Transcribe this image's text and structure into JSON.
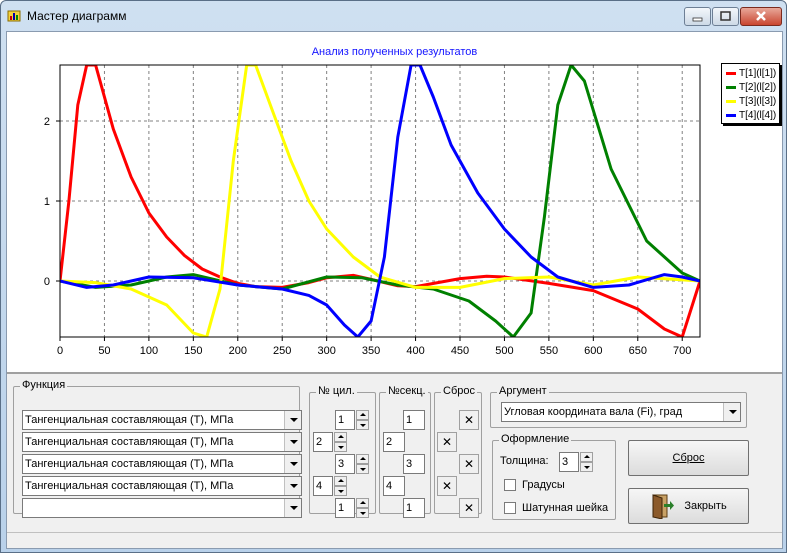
{
  "window": {
    "title": "Мастер диаграмм"
  },
  "chart_data": {
    "type": "line",
    "title": "Анализ полученных результатов",
    "xlim": [
      0,
      720
    ],
    "ylim": [
      -0.7,
      2.7
    ],
    "x_ticks": [
      "0",
      "50",
      "100",
      "150",
      "200",
      "250",
      "300",
      "350",
      "400",
      "450",
      "500",
      "550",
      "600",
      "650",
      "700"
    ],
    "y_ticks": [
      "2",
      "1",
      "0"
    ],
    "grid": true,
    "legend": "top-right",
    "series": [
      {
        "name": "T[1](l[1])",
        "color": "#ff0000",
        "x": [
          0,
          10,
          20,
          30,
          40,
          60,
          80,
          100,
          120,
          140,
          160,
          180,
          200,
          220,
          250,
          280,
          300,
          330,
          350,
          380,
          400,
          450,
          480,
          500,
          550,
          600,
          650,
          680,
          700,
          720
        ],
        "y": [
          0,
          1.0,
          2.2,
          2.7,
          2.7,
          1.9,
          1.3,
          0.85,
          0.55,
          0.32,
          0.15,
          0.05,
          -0.03,
          -0.07,
          -0.08,
          -0.02,
          0.04,
          0.07,
          0.02,
          -0.06,
          -0.07,
          0.03,
          0.06,
          0.05,
          -0.03,
          -0.12,
          -0.35,
          -0.6,
          -0.7,
          0
        ]
      },
      {
        "name": "T[2](l[2])",
        "color": "#008000",
        "x": [
          0,
          40,
          80,
          120,
          150,
          200,
          250,
          300,
          340,
          380,
          420,
          460,
          490,
          510,
          530,
          545,
          560,
          575,
          590,
          620,
          660,
          700,
          720
        ],
        "y": [
          0,
          -0.08,
          -0.05,
          0.05,
          0.08,
          -0.05,
          -0.1,
          0.05,
          0.04,
          -0.05,
          -0.1,
          -0.25,
          -0.5,
          -0.7,
          -0.4,
          0.8,
          2.2,
          2.7,
          2.5,
          1.4,
          0.5,
          0.1,
          0
        ]
      },
      {
        "name": "T[3](l[3])",
        "color": "#ffff00",
        "x": [
          0,
          40,
          80,
          120,
          150,
          165,
          180,
          195,
          210,
          220,
          240,
          260,
          280,
          300,
          330,
          360,
          400,
          450,
          500,
          550,
          600,
          650,
          720
        ],
        "y": [
          0,
          -0.02,
          -0.1,
          -0.3,
          -0.65,
          -0.7,
          -0.1,
          1.5,
          2.7,
          2.7,
          2.1,
          1.5,
          1.0,
          0.65,
          0.3,
          0.05,
          -0.08,
          -0.08,
          0.03,
          0.05,
          -0.05,
          0.05,
          0
        ]
      },
      {
        "name": "T[4](l[4])",
        "color": "#0000ff",
        "x": [
          0,
          30,
          60,
          100,
          150,
          200,
          250,
          280,
          300,
          320,
          335,
          350,
          365,
          380,
          395,
          405,
          420,
          440,
          470,
          500,
          530,
          560,
          600,
          640,
          680,
          700,
          720
        ],
        "y": [
          0,
          -0.08,
          -0.05,
          0.05,
          0.04,
          -0.05,
          -0.1,
          -0.18,
          -0.3,
          -0.55,
          -0.7,
          -0.5,
          0.3,
          1.8,
          2.7,
          2.7,
          2.3,
          1.7,
          1.1,
          0.65,
          0.3,
          0.05,
          -0.08,
          -0.05,
          0.08,
          0.05,
          0
        ]
      }
    ]
  },
  "function_group": {
    "label": "Функция",
    "rows": [
      "Тангенциальная составляющая (T), МПа",
      "Тангенциальная составляющая (T), МПа",
      "Тангенциальная составляющая (T), МПа",
      "Тангенциальная составляющая (T), МПа",
      ""
    ]
  },
  "cyl_group": {
    "label": "№ цил.",
    "values": [
      "1",
      "2",
      "3",
      "4",
      "1"
    ]
  },
  "sec_group": {
    "label": "№секц.",
    "values": [
      "1",
      "2",
      "3",
      "4",
      "1"
    ]
  },
  "reset_group": {
    "label": "Сброс",
    "x": "✕"
  },
  "argument_group": {
    "label": "Аргумент",
    "value": "Угловая координата вала (Fi), град"
  },
  "design_group": {
    "label": "Оформление",
    "thickness_label": "Толщина:",
    "thickness_value": "3",
    "degrees_label": "Градусы",
    "crank_label": "Шатунная шейка"
  },
  "buttons": {
    "reset_label": "Сброс",
    "close_label": "Закрыть"
  }
}
